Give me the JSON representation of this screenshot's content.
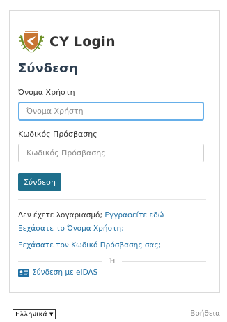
{
  "brand": {
    "name": "CY Login",
    "emblem": "cyprus-coat-of-arms-icon"
  },
  "form": {
    "title": "Σύνδεση",
    "username_label": "Όνομα Χρήστη",
    "username_placeholder": "Όνομα Χρήστη",
    "password_label": "Κωδικός Πρόσβασης",
    "password_placeholder": "Κωδικός Πρόσβασης",
    "submit_label": "Σύνδεση"
  },
  "links": {
    "no_account_text": "Δεν έχετε λογαριασμό;",
    "register_link": "Εγγραφείτε εδώ",
    "forgot_username": "Ξεχάσατε το Όνομα Χρήστη;",
    "forgot_password": "Ξεχάσατε τον Κωδικό Πρόσβασης σας;",
    "or_text": "Ή",
    "eidas_login": "Σύνδεση με eIDAS"
  },
  "footer": {
    "language": "Ελληνικά",
    "help": "Βοήθεια"
  },
  "colors": {
    "button": "#1e6f8c",
    "link": "#1f6fa3",
    "focus_border": "#66afe9",
    "emblem_copper": "#c87533",
    "emblem_olive": "#6b8e23"
  }
}
